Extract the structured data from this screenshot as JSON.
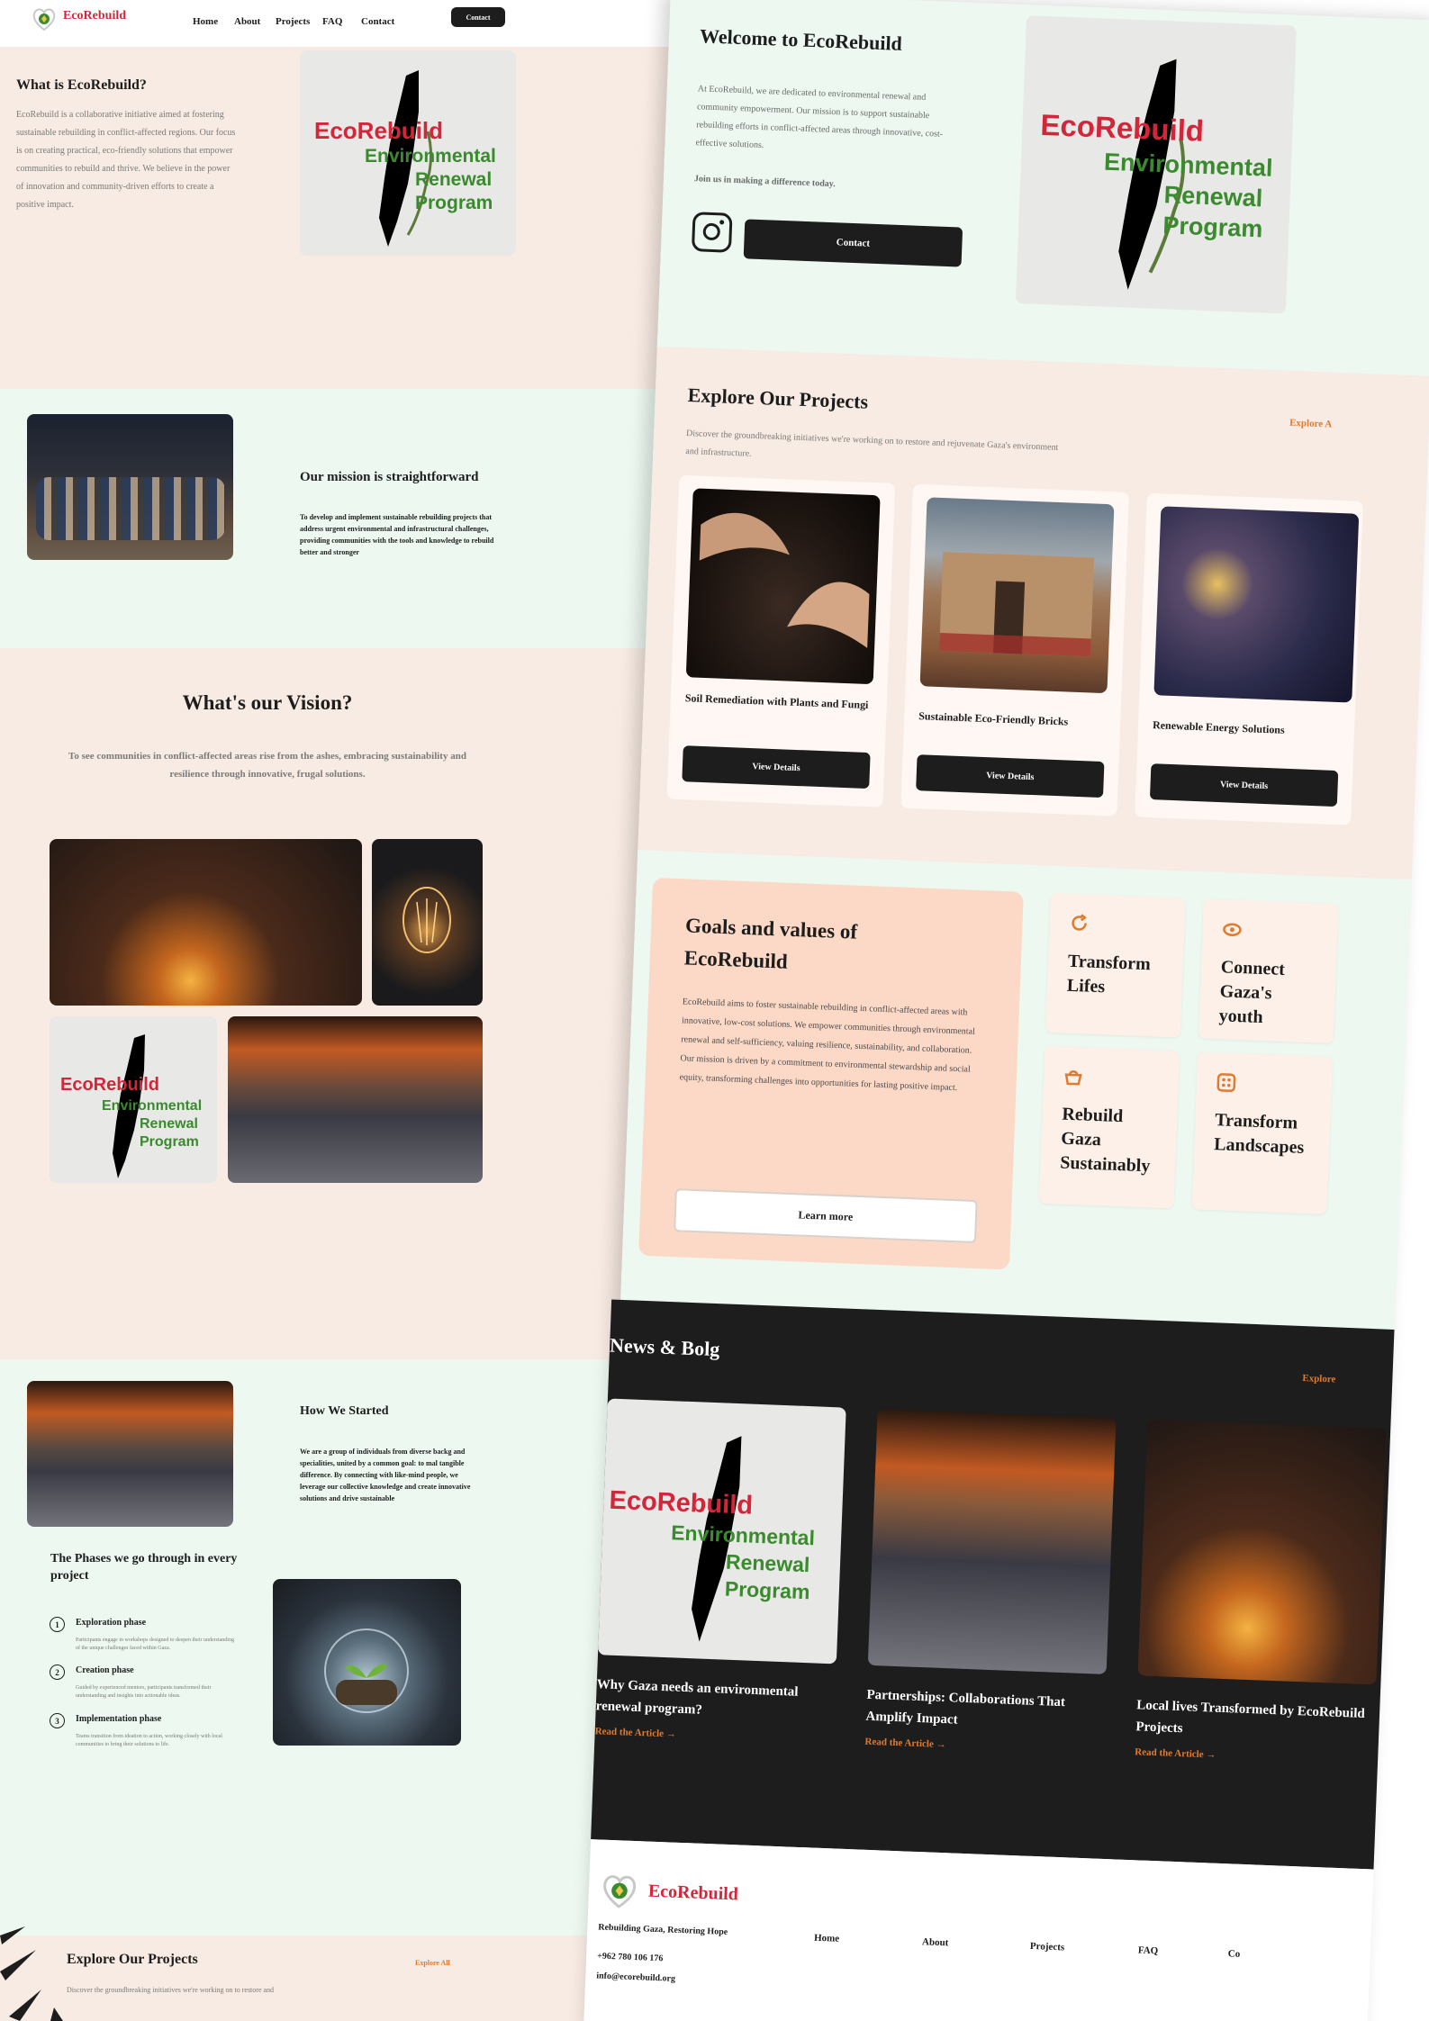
{
  "brand": {
    "name": "EcoRebuild",
    "accent": "#d4263a",
    "green": "#3a8a2e",
    "dark": "#1d1d1d",
    "orange": "#e07a2e"
  },
  "nav": {
    "links": [
      "Home",
      "About",
      "Projects",
      "FAQ",
      "Contact"
    ],
    "cta": "Contact"
  },
  "what": {
    "title": "What is EcoRebuild?",
    "body": "EcoRebuild is a collaborative initiative aimed at fostering sustainable rebuilding in conflict-affected regions. Our focus is on creating practical, eco-friendly solutions that empower communities to rebuild and thrive. We believe in the power of innovation and community-driven efforts to create a positive impact."
  },
  "poster": {
    "brand": "EcoRebuild",
    "line1": "Environmental",
    "line2": "Renewal",
    "line3": "Program"
  },
  "mission": {
    "title": "Our mission is straightforward",
    "body": "To develop and implement sustainable rebuilding projects that address urgent environmental and infrastructural challenges, providing communities with the tools and knowledge to rebuild better and stronger"
  },
  "vision": {
    "title": "What's our Vision?",
    "body": "To see communities in conflict-affected areas rise from the ashes, embracing sustainability and resilience through innovative, frugal solutions."
  },
  "started": {
    "title": "How We Started",
    "body": "We are a group of individuals from diverse backg and specialities, united by a common goal: to mal tangible difference. By connecting with like-mind people, we leverage our collective knowledge and create innovative solutions and drive sustainable"
  },
  "phases": {
    "title": "The Phases we go through in every project",
    "items": [
      {
        "num": "1",
        "title": "Exploration phase",
        "body": "Participants engage in workshops designed to deepen their understanding of the unique challenges faced within Gaza."
      },
      {
        "num": "2",
        "title": "Creation phase",
        "body": "Guided by experienced mentors, participants transformed their understanding and insights into actionable ideas."
      },
      {
        "num": "3",
        "title": "Implementation phase",
        "body": "Teams transition from ideation to action, working closely with local communities to bring their solutions to life."
      }
    ]
  },
  "explore_left": {
    "title": "Explore Our Projects",
    "link": "Explore All",
    "body": "Discover the groundbreaking initiatives we're working on to restore and"
  },
  "welcome": {
    "title": "Welcome to EcoRebuild",
    "body": "At EcoRebuild, we are dedicated to environmental renewal and community empowerment. Our mission is to support sustainable rebuilding efforts in conflict-affected areas through innovative, cost-effective solutions.",
    "join": "Join us in making a difference today.",
    "cta": "Contact"
  },
  "projects": {
    "title": "Explore Our Projects",
    "link": "Explore A",
    "body": "Discover the groundbreaking initiatives we're working on to restore and rejuvenate Gaza's environment and infrastructure.",
    "items": [
      {
        "title": "Soil Remediation with Plants and Fungi",
        "cta": "View Details"
      },
      {
        "title": "Sustainable Eco-Friendly Bricks",
        "cta": "View Details"
      },
      {
        "title": "Renewable Energy Solutions",
        "cta": "View Details"
      }
    ]
  },
  "goals": {
    "title": "Goals and values of EcoRebuild",
    "body": "EcoRebuild aims to foster sustainable rebuilding in conflict-affected areas with innovative, low-cost solutions. We empower communities through environmental renewal and self-sufficiency, valuing resilience, sustainability, and collaboration. Our mission is driven by a commitment to environmental stewardship and social equity, transforming challenges into opportunities for lasting positive impact.",
    "cta": "Learn more",
    "items": [
      {
        "label": "Transform Lifes",
        "icon": "refresh-icon"
      },
      {
        "label": "Connect Gaza's youth",
        "icon": "eye-icon"
      },
      {
        "label": "Rebuild Gaza Sustainably",
        "icon": "basket-icon"
      },
      {
        "label": "Transform Landscapes",
        "icon": "grid-icon"
      }
    ]
  },
  "news": {
    "title": "News & Bolg",
    "link": "Explore",
    "items": [
      {
        "title": "Why Gaza needs an environmental renewal program?",
        "cta": "Read the Article"
      },
      {
        "title": "Partnerships: Collaborations That Amplify Impact",
        "cta": "Read the Article"
      },
      {
        "title": "Local lives Transformed by EcoRebuild Projects",
        "cta": "Read the Article"
      }
    ]
  },
  "footer": {
    "brand": "EcoRebuild",
    "tagline": "Rebuilding Gaza, Restoring Hope",
    "phone": "+962 780 106 176",
    "email": "info@ecorebuild.org",
    "links": [
      "Home",
      "About",
      "Projects",
      "FAQ",
      "Co"
    ]
  }
}
